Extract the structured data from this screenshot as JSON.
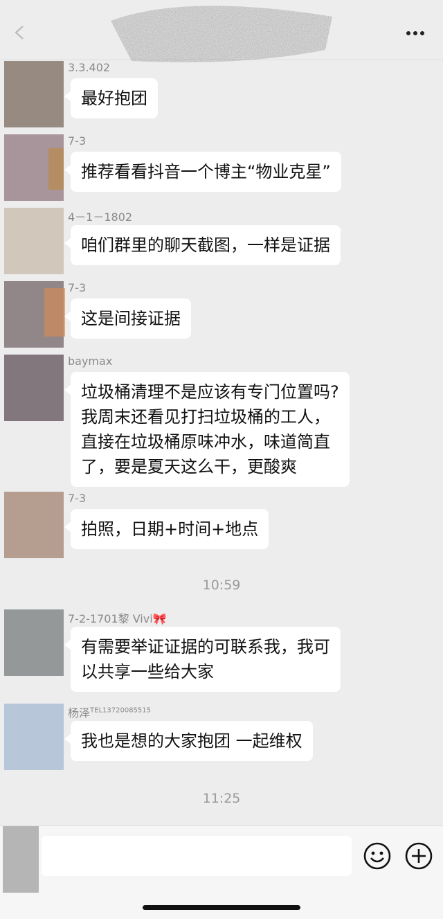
{
  "header": {
    "back_icon": "chevron-left-icon",
    "more_icon": "ellipsis-icon"
  },
  "messages": [
    {
      "sender": "3.3.402",
      "text": "最好抱团"
    },
    {
      "sender": "7-3",
      "text": "推荐看看抖音一个博主“物业克星”"
    },
    {
      "sender": "4－1－1802",
      "text": "咱们群里的聊天截图，一样是证据"
    },
    {
      "sender": "7-3",
      "text": "这是间接证据"
    },
    {
      "sender": "baymax",
      "text": "垃圾桶清理不是应该有专门位置吗?\n我周末还看见打扫垃圾桶的工人，\n直接在垃圾桶原味冲水，味道简直\n了，要是夏天这么干，更酸爽"
    },
    {
      "sender": "7-3",
      "text": "拍照，日期+时间+地点"
    },
    {
      "sender": "7-2-1701黎 Vivi🎀",
      "text": "有需要举证证据的可联系我，我可\n以共享一些给大家"
    },
    {
      "sender": "杨泽",
      "sender_tel": "TEL13720085515",
      "text": "我也是想的大家抱团 一起维权"
    }
  ],
  "timestamps": [
    "10:59",
    "11:25"
  ],
  "input": {
    "value": "",
    "emoji_icon": "smiley-icon",
    "add_icon": "plus-circle-icon"
  }
}
